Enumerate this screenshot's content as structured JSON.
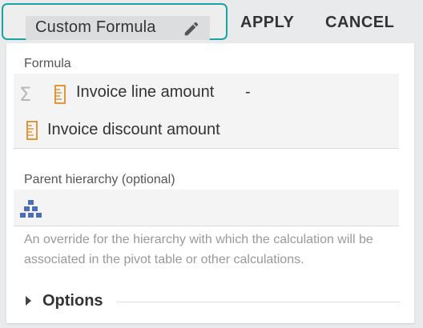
{
  "header": {
    "title": "Custom Formula",
    "apply_label": "APPLY",
    "cancel_label": "CANCEL",
    "edit_icon": "pencil-icon",
    "accent_color": "#1aa3a3"
  },
  "formula": {
    "label": "Formula",
    "function_icon": "sigma-icon",
    "terms": [
      {
        "icon": "measure-icon",
        "text": "Invoice line amount",
        "operator": "-"
      },
      {
        "icon": "measure-icon",
        "text": "Invoice discount amount",
        "operator": ""
      }
    ]
  },
  "parent_hierarchy": {
    "label": "Parent hierarchy (optional)",
    "icon": "hierarchy-icon",
    "help_text": "An override for the hierarchy with which the calculation will be associated in the pivot table or other calculations."
  },
  "options": {
    "label": "Options",
    "icon": "caret-right-icon"
  }
}
